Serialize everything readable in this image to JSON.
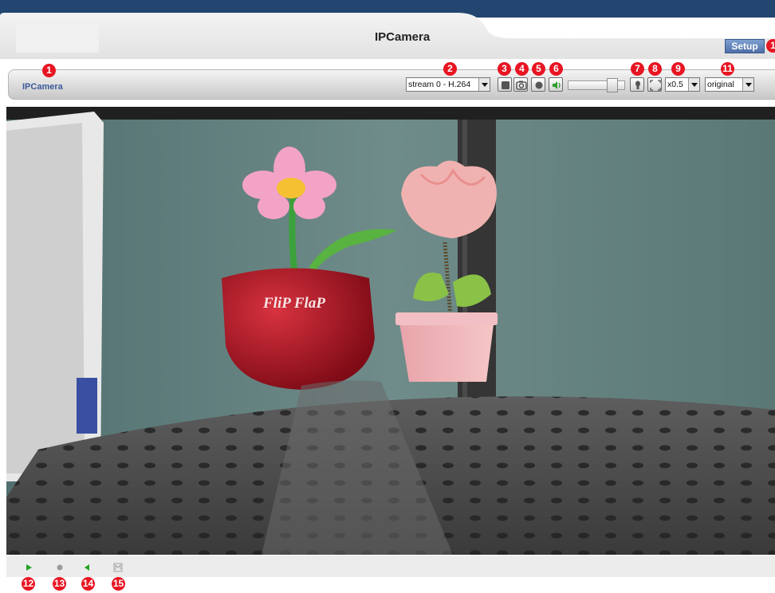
{
  "header": {
    "title": "IPCamera",
    "setup_label": "Setup"
  },
  "toolbar": {
    "camera_name": "IPCamera",
    "stream": {
      "value": "stream 0 - H.264"
    },
    "zoom": {
      "value": "x0.5"
    },
    "size": {
      "value": "original"
    },
    "volume_level": 0.85
  },
  "video": {
    "pot_text": "FliP FlaP"
  },
  "callouts": {
    "c1": "1",
    "c2": "2",
    "c3": "3",
    "c4": "4",
    "c5": "5",
    "c6": "6",
    "c7": "7",
    "c8": "8",
    "c9": "9",
    "c10": "1",
    "c11": "11",
    "c12": "12",
    "c13": "13",
    "c14": "14",
    "c15": "15"
  },
  "colors": {
    "header_blue": "#22466f",
    "callout_red": "#e81522",
    "link_blue": "#3d5a9a",
    "setup_blue": "#5a7bb3"
  },
  "icons": {
    "stop": "stop-icon",
    "snapshot": "camera-icon",
    "record": "record-icon",
    "audio": "speaker-icon",
    "light": "bulb-icon",
    "fullscreen": "fullscreen-icon",
    "play": "play-icon",
    "record_status": "dot-icon",
    "talk": "talk-icon",
    "mute": "mute-icon"
  }
}
